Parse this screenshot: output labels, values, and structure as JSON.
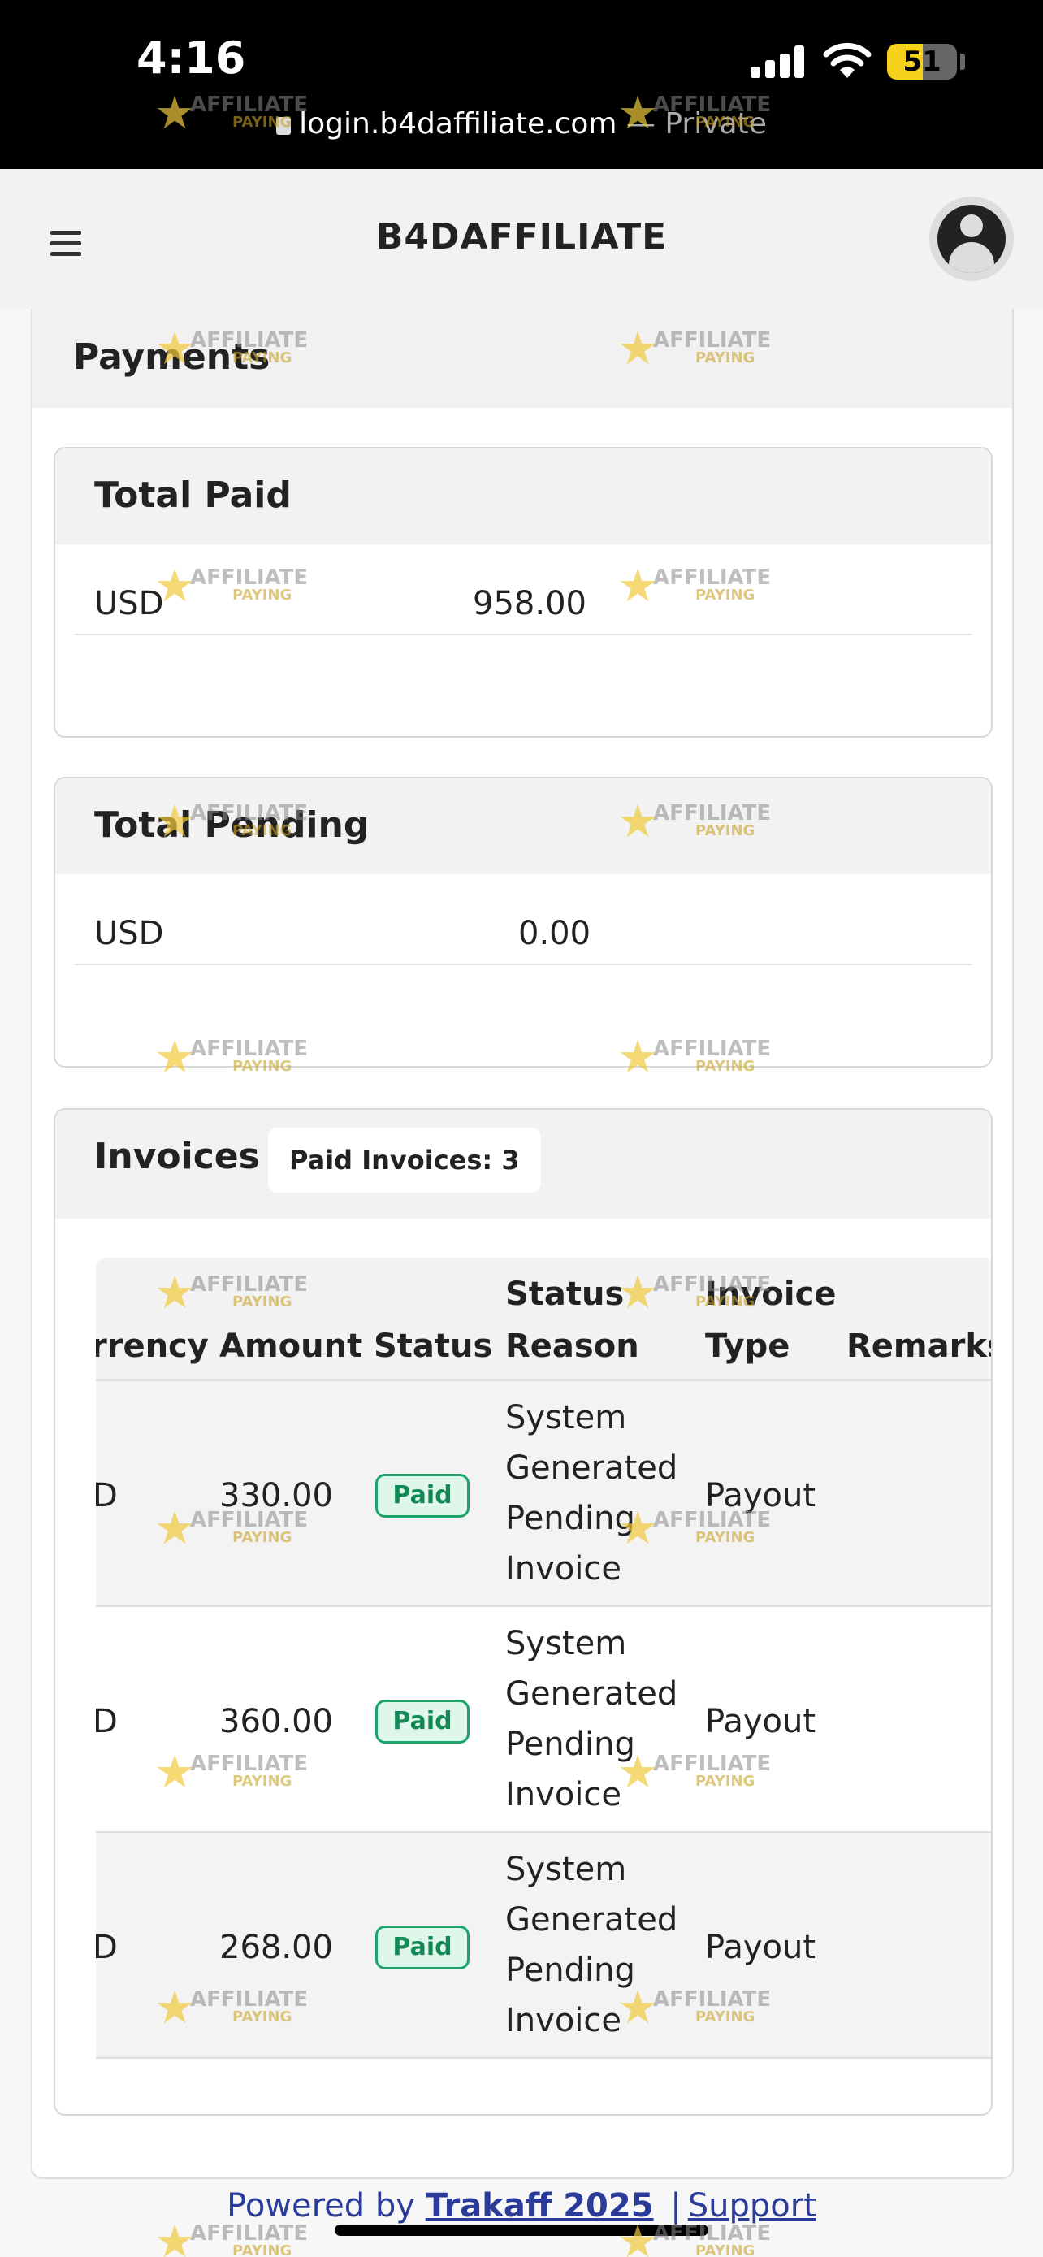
{
  "status_bar": {
    "time": "4:16",
    "battery": "51",
    "url": "login.b4daffiliate.com",
    "url_suffix": "— Private"
  },
  "app": {
    "brand": "B4DAFFILIATE"
  },
  "payments": {
    "title": "Payments",
    "total_paid": {
      "title": "Total Paid",
      "currency": "USD",
      "amount": "958.00"
    },
    "total_pending": {
      "title": "Total Pending",
      "currency": "USD",
      "amount": "0.00"
    }
  },
  "invoices": {
    "title": "Invoices",
    "badge": "Paid Invoices: 3",
    "columns": {
      "currency": "rrency",
      "amount": "Amount",
      "status": "Status",
      "status_reason_1": "Status",
      "status_reason_2": "Reason",
      "invoice_type_1": "Invoice",
      "invoice_type_2": "Type",
      "remarks": "Remarks"
    },
    "rows": [
      {
        "currency": "D",
        "amount": "330.00",
        "status": "Paid",
        "reason": [
          "System",
          "Generated",
          "Pending",
          "Invoice"
        ],
        "type": "Payout"
      },
      {
        "currency": "D",
        "amount": "360.00",
        "status": "Paid",
        "reason": [
          "System",
          "Generated",
          "Pending",
          "Invoice"
        ],
        "type": "Payout"
      },
      {
        "currency": "D",
        "amount": "268.00",
        "status": "Paid",
        "reason": [
          "System",
          "Generated",
          "Pending",
          "Invoice"
        ],
        "type": "Payout"
      }
    ]
  },
  "footer": {
    "prefix": "Powered by",
    "brand": "Trakaff 2025",
    "separator": "|",
    "support": "Support"
  },
  "watermark": {
    "line1": "AFFILIATE",
    "line2": "PAYING",
    "color": "#f0c93a"
  }
}
